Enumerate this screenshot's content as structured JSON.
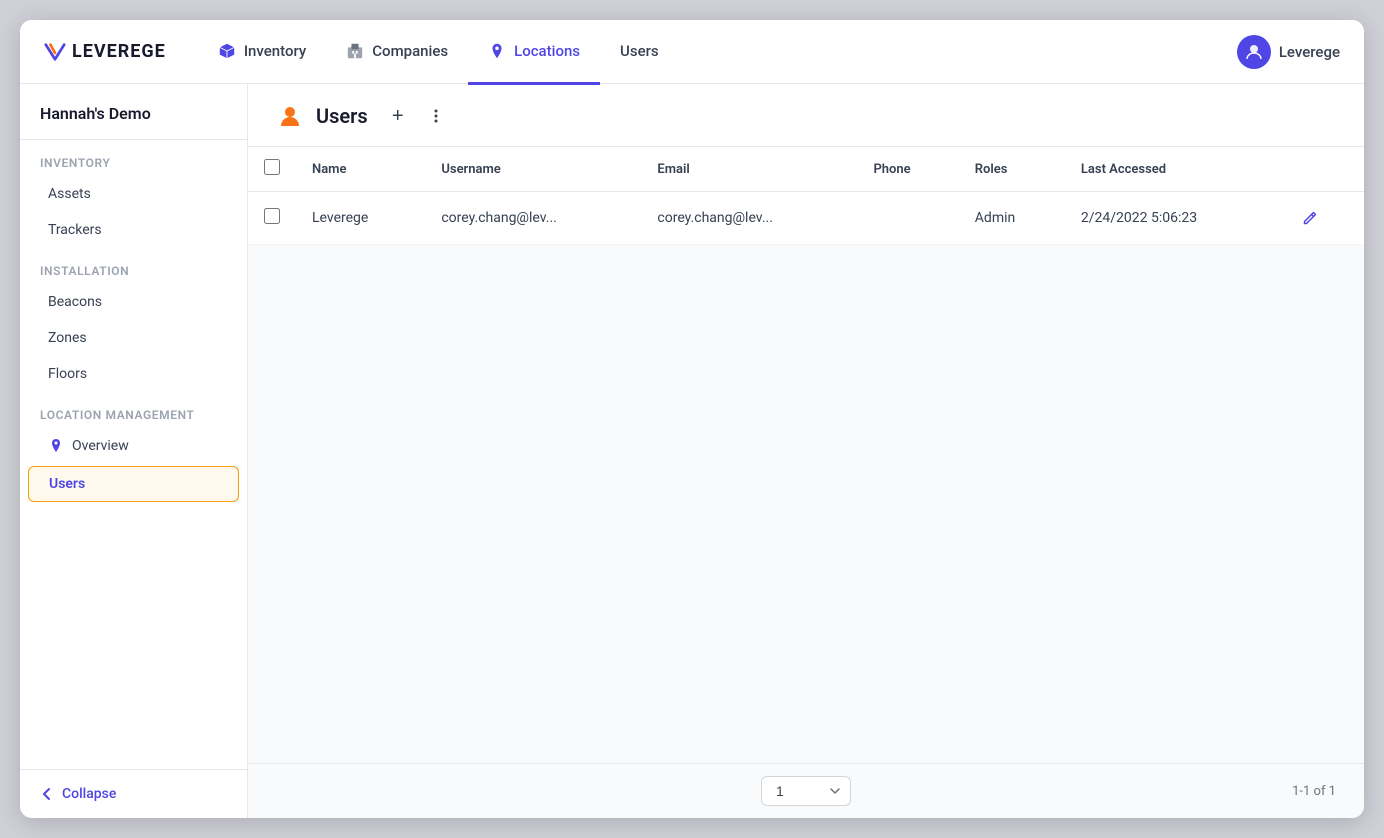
{
  "brand": {
    "name": "LEVEREGE"
  },
  "nav": {
    "items": [
      {
        "id": "inventory",
        "label": "Inventory",
        "icon": "cube-icon",
        "active": false
      },
      {
        "id": "companies",
        "label": "Companies",
        "icon": "building-icon",
        "active": false
      },
      {
        "id": "locations",
        "label": "Locations",
        "icon": "pin-icon",
        "active": true
      },
      {
        "id": "users",
        "label": "Users",
        "icon": null,
        "active": false
      }
    ],
    "user_label": "Leverege"
  },
  "sidebar": {
    "header": "Hannah's Demo",
    "sections": [
      {
        "label": "Inventory",
        "items": [
          {
            "id": "assets",
            "label": "Assets",
            "active": false
          },
          {
            "id": "trackers",
            "label": "Trackers",
            "active": false
          }
        ]
      },
      {
        "label": "Installation",
        "items": [
          {
            "id": "beacons",
            "label": "Beacons",
            "active": false
          },
          {
            "id": "zones",
            "label": "Zones",
            "active": false
          },
          {
            "id": "floors",
            "label": "Floors",
            "active": false
          }
        ]
      },
      {
        "label": "Location Management",
        "items": [
          {
            "id": "overview",
            "label": "Overview",
            "icon": true,
            "active": false
          },
          {
            "id": "users",
            "label": "Users",
            "icon": false,
            "active": true
          }
        ]
      }
    ],
    "collapse_label": "Collapse"
  },
  "content": {
    "page_title": "Users",
    "add_label": "+",
    "table": {
      "columns": [
        "Name",
        "Username",
        "Email",
        "Phone",
        "Roles",
        "Last Accessed"
      ],
      "rows": [
        {
          "name": "Leverege",
          "username": "corey.chang@lev...",
          "email": "corey.chang@lev...",
          "phone": "",
          "roles": "Admin",
          "last_accessed": "2/24/2022 5:06:23"
        }
      ]
    }
  },
  "pagination": {
    "page": "1",
    "info": "1-1 of 1"
  }
}
